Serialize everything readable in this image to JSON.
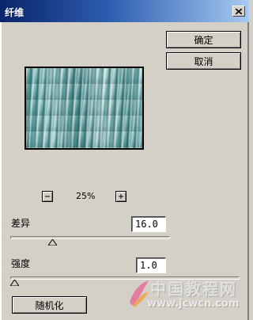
{
  "dialog": {
    "title": "纤维",
    "close_glyph": "×"
  },
  "buttons": {
    "ok": "确定",
    "cancel": "取消",
    "randomize": "随机化"
  },
  "preview": {
    "zoom_value": "25%",
    "zoom_out_icon": "minus-icon",
    "zoom_in_icon": "plus-icon"
  },
  "variance": {
    "label": "差异",
    "value": "16.0",
    "slider_fraction": 0.25
  },
  "strength": {
    "label": "强度",
    "value": "1.0",
    "slider_fraction": 0.0
  },
  "watermark": {
    "line1": "中国教程网",
    "line2": "www.jcwcn.com"
  },
  "colors": {
    "title_bar_start": "#0a246a",
    "title_bar_end": "#a6caf0",
    "dialog_background": "#d4d0c8",
    "preview_tint": "#5ea3a3"
  }
}
